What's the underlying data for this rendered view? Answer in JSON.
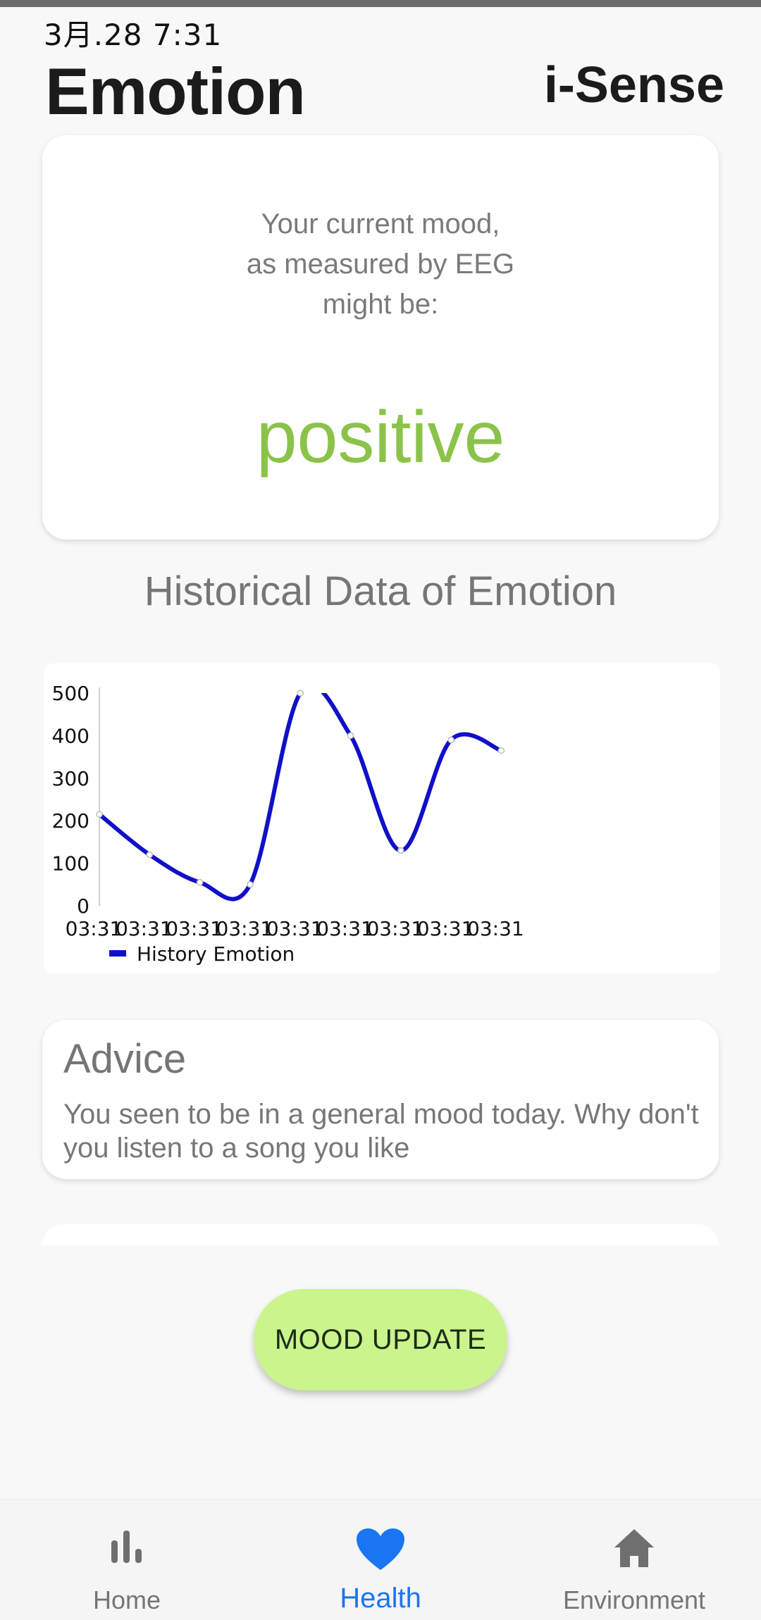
{
  "status_bar": {
    "time": "3月.28 7:31"
  },
  "header": {
    "title": "Emotion",
    "brand": "i-Sense"
  },
  "mood_card": {
    "prompt_lines": [
      "Your current mood,",
      "as measured by EEG",
      "might be:"
    ],
    "mood": "positive",
    "mood_color": "#8bc34a"
  },
  "history": {
    "title": "Historical Data of Emotion"
  },
  "chart_data": {
    "type": "line",
    "x": [
      "03:31",
      "03:31",
      "03:31",
      "03:31",
      "03:31",
      "03:31",
      "03:31",
      "03:31",
      "03:31"
    ],
    "y_ticks": [
      "0",
      "100",
      "200",
      "300",
      "400",
      "500"
    ],
    "ylim": [
      0,
      500
    ],
    "grid": false,
    "legend_position": "bottom-left",
    "series": [
      {
        "name": "History Emotion",
        "color": "#1010c8",
        "values": [
          215,
          120,
          55,
          50,
          500,
          400,
          130,
          390,
          365
        ]
      }
    ]
  },
  "advice": {
    "title": "Advice",
    "text": "You seen to be in a general mood today. Why don't you listen to a song you like"
  },
  "actions": {
    "mood_update": "MOOD UPDATE"
  },
  "nav": {
    "items": [
      {
        "label": "Home",
        "icon": "bar-chart-icon",
        "active": false
      },
      {
        "label": "Health",
        "icon": "heart-icon",
        "active": true
      },
      {
        "label": "Environment",
        "icon": "home-icon",
        "active": false
      }
    ],
    "active_color": "#1976f2",
    "inactive_color": "#757575"
  }
}
